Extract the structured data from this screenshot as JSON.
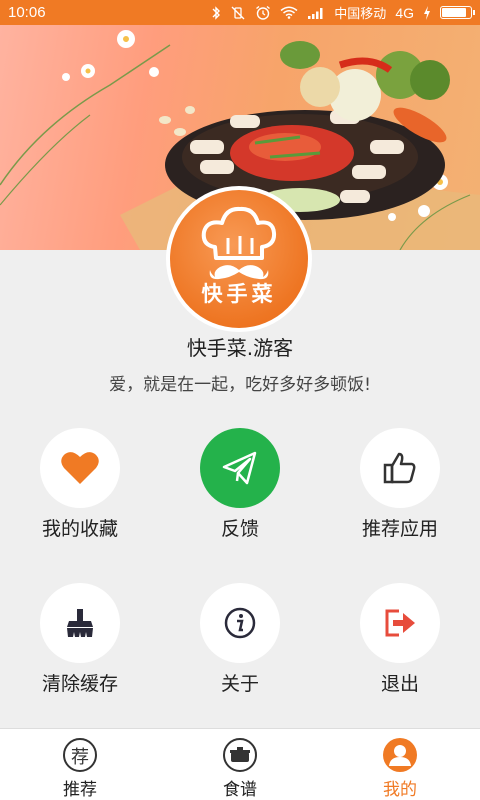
{
  "status_bar": {
    "time": "10:06",
    "carrier": "中国移动",
    "network": "4G",
    "battery_level": 0.9,
    "icons": [
      "bluetooth-icon",
      "vibrate-off-icon",
      "alarm-icon",
      "wifi-icon",
      "signal-icon",
      "charging-icon",
      "battery-icon"
    ]
  },
  "profile": {
    "logo_text": "快手菜",
    "username": "快手菜.游客",
    "motto": "爱，就是在一起，吃好多好多顿饭!"
  },
  "grid": [
    {
      "label": "我的收藏",
      "icon": "heart-icon",
      "color": "#f07a24"
    },
    {
      "label": "反馈",
      "icon": "paper-plane-icon",
      "color": "#ffffff",
      "bg": "#24b24b"
    },
    {
      "label": "推荐应用",
      "icon": "thumbs-up-icon",
      "color": "#333333"
    },
    {
      "label": "清除缓存",
      "icon": "broom-icon",
      "color": "#2a2a3a"
    },
    {
      "label": "关于",
      "icon": "info-icon",
      "color": "#2a2a3a"
    },
    {
      "label": "退出",
      "icon": "logout-icon",
      "color": "#e74c3c"
    }
  ],
  "tabbar": {
    "tabs": [
      {
        "label": "推荐",
        "icon": "recommend-icon",
        "icon_char": "荐",
        "active": false
      },
      {
        "label": "食谱",
        "icon": "pot-icon",
        "active": false
      },
      {
        "label": "我的",
        "icon": "user-icon",
        "active": true
      }
    ]
  },
  "colors": {
    "accent": "#f07a24",
    "green": "#24b24b",
    "background": "#efefef"
  }
}
